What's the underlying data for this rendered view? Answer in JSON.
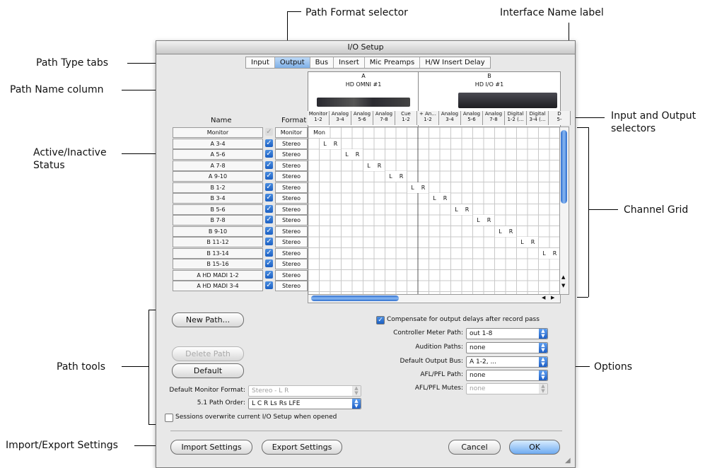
{
  "callouts": {
    "path_format_selector": "Path Format selector",
    "interface_name_label": "Interface Name label",
    "path_type_tabs": "Path Type tabs",
    "path_name_column": "Path Name column",
    "input_output_selectors": "Input and Output\nselectors",
    "active_inactive_status": "Active/Inactive\nStatus",
    "channel_grid": "Channel Grid",
    "path_tools": "Path tools",
    "options": "Options",
    "import_export_settings": "Import/Export Settings"
  },
  "window": {
    "title": "I/O Setup"
  },
  "tabs": [
    {
      "label": "Input",
      "selected": false
    },
    {
      "label": "Output",
      "selected": true
    },
    {
      "label": "Bus",
      "selected": false
    },
    {
      "label": "Insert",
      "selected": false
    },
    {
      "label": "Mic Preamps",
      "selected": false
    },
    {
      "label": "H/W Insert Delay",
      "selected": false
    }
  ],
  "columns": {
    "name": "Name",
    "format": "Format"
  },
  "interfaces": [
    {
      "letter": "A",
      "name": "HD OMNI #1"
    },
    {
      "letter": "B",
      "name": "HD I/O #1"
    }
  ],
  "io_selectors": [
    [
      "Monitor",
      "1-2"
    ],
    [
      "Analog",
      "3-4"
    ],
    [
      "Analog",
      "5-6"
    ],
    [
      "Analog",
      "7-8"
    ],
    [
      "Cue",
      "1-2"
    ],
    [
      "+ An...",
      "1-2"
    ],
    [
      "Analog",
      "3-4"
    ],
    [
      "Analog",
      "5-6"
    ],
    [
      "Analog",
      "7-8"
    ],
    [
      "Digital",
      "1-2 (..."
    ],
    [
      "Digital",
      "3-4 (..."
    ],
    [
      "D",
      "5-"
    ]
  ],
  "paths": [
    {
      "name": "Monitor",
      "active": false,
      "format": "Monitor",
      "grid": "Mon"
    },
    {
      "name": "A 3-4",
      "active": true,
      "format": "Stereo"
    },
    {
      "name": "A 5-6",
      "active": true,
      "format": "Stereo"
    },
    {
      "name": "A 7-8",
      "active": true,
      "format": "Stereo"
    },
    {
      "name": "A 9-10",
      "active": true,
      "format": "Stereo"
    },
    {
      "name": "B 1-2",
      "active": true,
      "format": "Stereo"
    },
    {
      "name": "B 3-4",
      "active": true,
      "format": "Stereo"
    },
    {
      "name": "B 5-6",
      "active": true,
      "format": "Stereo"
    },
    {
      "name": "B 7-8",
      "active": true,
      "format": "Stereo"
    },
    {
      "name": "B 9-10",
      "active": true,
      "format": "Stereo"
    },
    {
      "name": "B 11-12",
      "active": true,
      "format": "Stereo"
    },
    {
      "name": "B 13-14",
      "active": true,
      "format": "Stereo"
    },
    {
      "name": "B 15-16",
      "active": true,
      "format": "Stereo"
    },
    {
      "name": "A HD MADI 1-2",
      "active": true,
      "format": "Stereo"
    },
    {
      "name": "A HD MADI 3-4",
      "active": true,
      "format": "Stereo"
    }
  ],
  "channel_labels": {
    "left": "L",
    "right": "R"
  },
  "path_tools": {
    "new_path": "New Path...",
    "delete_path": "Delete Path",
    "default": "Default",
    "default_monitor_format_label": "Default Monitor Format:",
    "default_monitor_format_value": "Stereo - L R",
    "path_order_label": "5.1 Path Order:",
    "path_order_value": "L C R Ls Rs LFE",
    "sessions_overwrite": "Sessions overwrite current I/O Setup when opened"
  },
  "options": {
    "compensate": "Compensate for output delays after record pass",
    "controller_meter_label": "Controller Meter Path:",
    "controller_meter_value": "out 1-8",
    "audition_label": "Audition Paths:",
    "audition_value": "none",
    "default_output_label": "Default Output Bus:",
    "default_output_value": "A 1-2, ...",
    "afl_pfl_path_label": "AFL/PFL Path:",
    "afl_pfl_path_value": "none",
    "afl_pfl_mutes_label": "AFL/PFL Mutes:",
    "afl_pfl_mutes_value": "none"
  },
  "footer": {
    "import": "Import Settings",
    "export": "Export Settings",
    "cancel": "Cancel",
    "ok": "OK"
  }
}
